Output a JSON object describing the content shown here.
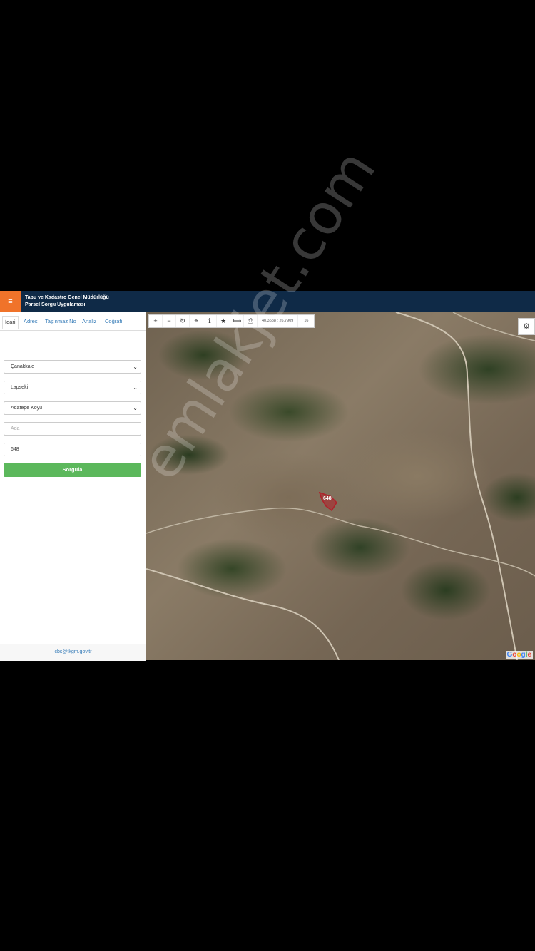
{
  "header": {
    "title_line1": "Tapu ve Kadastro Genel Müdürlüğü",
    "title_line2": "Parsel Sorgu Uygulaması",
    "menu_icon": "list-icon"
  },
  "sidebar": {
    "tabs": [
      "İdari",
      "Adres",
      "Taşınmaz No",
      "Analiz",
      "Coğrafi"
    ],
    "active_tab": "İdari",
    "province": "Çanakkale",
    "district": "Lapseki",
    "village": "Adatepe Köyü",
    "ada_placeholder": "Ada",
    "parsel_value": "648",
    "query_button": "Sorgula",
    "footer_email": "cbs@tkgm.gov.tr"
  },
  "map": {
    "coordinates": "40.3588 : 26.7909",
    "zoom_level": "16",
    "parcel_label": "648",
    "provider": "Google",
    "tools": [
      "plus-icon",
      "minus-icon",
      "refresh-icon",
      "crosshair-icon",
      "info-icon",
      "star-icon",
      "measure-icon",
      "print-icon"
    ],
    "settings_icon": "gear-icon"
  },
  "watermark": "emlakjet.com",
  "colors": {
    "header_bg": "#0f2a47",
    "menu_button": "#f0732a",
    "query_button": "#5cb85c",
    "parcel_outline": "#b0202a"
  }
}
